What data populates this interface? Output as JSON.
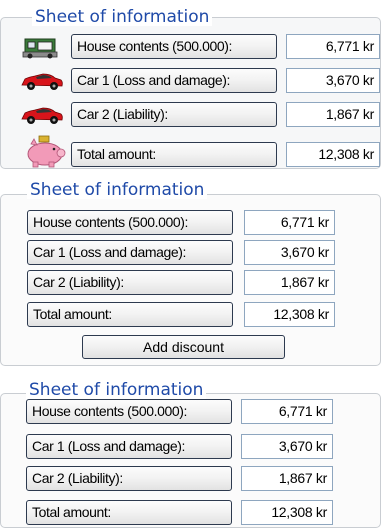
{
  "panels": [
    {
      "title": "Sheet of information",
      "rows": [
        {
          "label": "House contents (500.000):",
          "value": "6,771 kr",
          "icon": "house-icon"
        },
        {
          "label": "Car 1 (Loss and damage):",
          "value": "3,670 kr",
          "icon": "red-car-icon"
        },
        {
          "label": "Car 2 (Liability):",
          "value": "1,867 kr",
          "icon": "red-car-icon"
        },
        {
          "label": "Total amount:",
          "value": "12,308 kr",
          "icon": "piggy-bank-icon"
        }
      ]
    },
    {
      "title": "Sheet of information",
      "rows": [
        {
          "label": "House contents (500.000):",
          "value": "6,771 kr"
        },
        {
          "label": "Car 1 (Loss and damage):",
          "value": "3,670 kr"
        },
        {
          "label": "Car 2 (Liability):",
          "value": "1,867 kr"
        },
        {
          "label": "Total amount:",
          "value": "12,308 kr"
        }
      ],
      "discount_button": "Add discount"
    },
    {
      "title": "Sheet of information",
      "rows": [
        {
          "label": "House contents (500.000):",
          "value": "6,771 kr"
        },
        {
          "label": "Car 1 (Loss and damage):",
          "value": "3,670 kr"
        },
        {
          "label": "Car 2 (Liability):",
          "value": "1,867 kr"
        },
        {
          "label": "Total amount:",
          "value": "12,308 kr"
        }
      ]
    }
  ],
  "colors": {
    "title": "#1f4aa8",
    "button_border": "#2d3a4f",
    "value_border": "#8ea6bf",
    "panel_border": "#c9cdd2"
  }
}
